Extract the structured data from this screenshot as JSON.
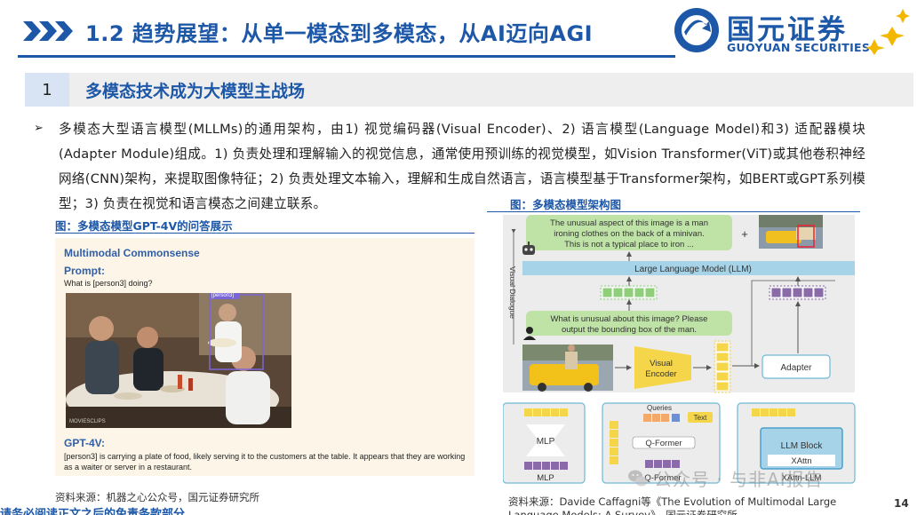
{
  "header": {
    "title": "1.2 趋势展望：从单一模态到多模态，从AI迈向AGI",
    "logo_cn": "国元证券",
    "logo_en": "GUOYUAN SECURITIES"
  },
  "section": {
    "number": "1",
    "title": "多模态技术成为大模型主战场"
  },
  "body": {
    "paragraph": "多模态大型语言模型(MLLMs)的通用架构，由1) 视觉编码器(Visual Encoder)、2) 语言模型(Language Model)和3) 适配器模块(Adapter Module)组成。1) 负责处理和理解输入的视觉信息，通常使用预训练的视觉模型，如Vision Transformer(ViT)或其他卷积神经网络(CNN)架构，来提取图像特征；2) 负责处理文本输入，理解和生成自然语言，语言模型基于Transformer架构，如BERT或GPT系列模型；3) 负责在视觉和语言模态之间建立联系。"
  },
  "figure_left": {
    "caption": "图：多模态模型GPT-4V的问答展示",
    "heading": "Multimodal Commonsense",
    "prompt_label": "Prompt:",
    "prompt_text": "What is [person3] doing?",
    "tag_label": "[person3]",
    "photo_credit": "MOVIESCLIPS",
    "answer_label": "GPT-4V:",
    "answer_text": "[person3] is carrying a plate of food, likely serving it to the customers at the table. It appears that they are working as a waiter or server in a restaurant.",
    "source": "资料来源：机器之心公众号，国元证券研究所"
  },
  "figure_right": {
    "caption": "图：多模态模型架构图",
    "output_text_1": "The unusual aspect of this image is a man",
    "output_text_2": "ironing clothes on the back of a minivan.",
    "output_text_3": "This is not a typical place to iron ...",
    "plus": "+",
    "llm_label": "Large Language Model (LLM)",
    "side_label": "Visual Dialogue",
    "question_1": "What is unusual about this image? Please",
    "question_2": "output the bounding box of the man.",
    "encoder_1": "Visual",
    "encoder_2": "Encoder",
    "adapter": "Adapter",
    "mlp_top": "MLP",
    "mlp_bottom": "MLP",
    "queries": "Queries",
    "text_tag": "Text",
    "qformer_top": "Q-Former",
    "qformer_bottom": "Q-Former",
    "llm_block": "LLM Block",
    "xattn": "XAttn",
    "xattn_llm": "XAttn-LLM",
    "source": "资料来源：Davide Caffagni等《The Evolution of Multimodal Large Language Models: A Survey》，国元证券研究所"
  },
  "footer": {
    "disclaimer": "请务必阅读正文之后的免责条款部分",
    "page_number": "14",
    "watermark": "公众号 · 与非AI报告"
  },
  "colors": {
    "brand_blue": "#1d57a8",
    "llm_bar": "#a7d3e8",
    "token_green": "#8fcf7a",
    "token_yellow": "#f5d54a",
    "token_purple": "#8a6aa8",
    "panel_gray": "#ececec",
    "panel_border": "#6fb9d6"
  }
}
